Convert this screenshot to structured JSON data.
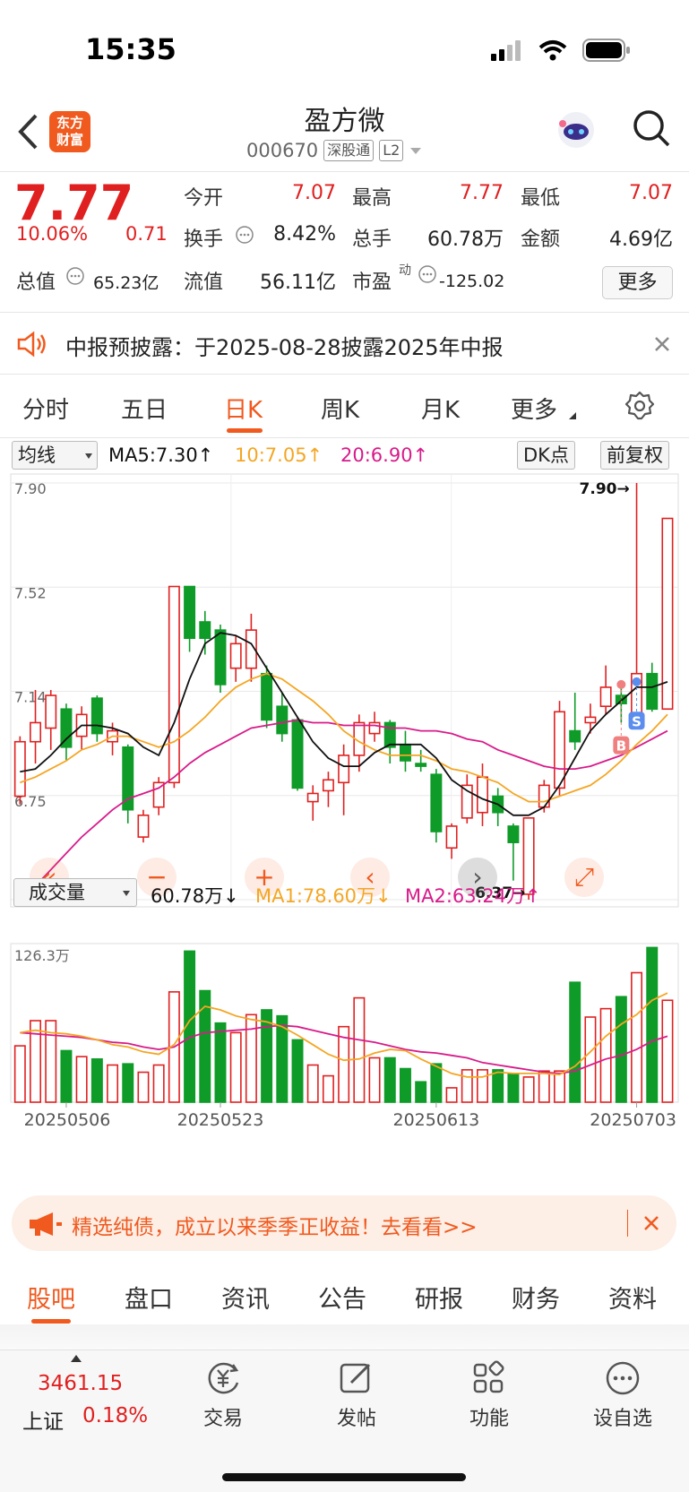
{
  "status": {
    "time": "15:35"
  },
  "header": {
    "logo_text": [
      "东方",
      "财富"
    ],
    "stock_name": "盈方微",
    "stock_code": "000670",
    "badge_market": "深股通",
    "badge_level": "L2"
  },
  "quote": {
    "price": "7.77",
    "change_pct": "10.06%",
    "change_amt": "0.71",
    "open_label": "今开",
    "open": "7.07",
    "high_label": "最高",
    "high": "7.77",
    "low_label": "最低",
    "low": "7.07",
    "turnover_label": "换手",
    "turnover": "8.42%",
    "volume_label": "总手",
    "volume": "60.78万",
    "amount_label": "金额",
    "amount": "4.69亿",
    "mktcap_label": "总值",
    "mktcap": "65.23亿",
    "float_label": "流值",
    "float": "56.11亿",
    "pe_label": "市盈",
    "pe_sup": "动",
    "pe": "-125.02",
    "more_label": "更多"
  },
  "notice": {
    "text": "中报预披露：于2025-08-28披露2025年中报"
  },
  "period_tabs": [
    {
      "label": "分时"
    },
    {
      "label": "五日"
    },
    {
      "label": "日K",
      "active": true
    },
    {
      "label": "周K"
    },
    {
      "label": "月K"
    },
    {
      "label": "更多"
    }
  ],
  "chart_controls": {
    "indicator": "均线",
    "ma5": "MA5:7.30↑",
    "ma10": "10:7.05↑",
    "ma20": "20:6.90↑",
    "dk": "DK点",
    "adjust": "前复权",
    "vol_indicator": "成交量",
    "vol_value": "60.78万↓",
    "vol_ma1": "MA1:78.60万↓",
    "vol_ma2": "MA2:63.24万↑"
  },
  "chart_data": {
    "type": "candlestick",
    "price_axis_ticks": [
      "7.90",
      "7.52",
      "7.14",
      "6.75",
      "6.37"
    ],
    "ylim": [
      6.37,
      7.9
    ],
    "annotations": {
      "max_label": "7.90→",
      "min_label": "6.37→",
      "buy_marker": "B",
      "sell_marker": "S"
    },
    "x_tick_labels": [
      "20250506",
      "20250523",
      "20250613",
      "20250703"
    ],
    "candles": [
      {
        "o": 6.75,
        "c": 6.95,
        "h": 6.97,
        "l": 6.72
      },
      {
        "o": 6.95,
        "c": 7.02,
        "h": 7.14,
        "l": 6.87
      },
      {
        "o": 7.0,
        "c": 7.12,
        "h": 7.14,
        "l": 6.92
      },
      {
        "o": 7.07,
        "c": 6.93,
        "h": 7.09,
        "l": 6.88
      },
      {
        "o": 6.97,
        "c": 7.05,
        "h": 7.08,
        "l": 6.92
      },
      {
        "o": 7.11,
        "c": 6.98,
        "h": 7.12,
        "l": 6.95
      },
      {
        "o": 6.95,
        "c": 6.99,
        "h": 7.02,
        "l": 6.9
      },
      {
        "o": 6.93,
        "c": 6.7,
        "h": 6.94,
        "l": 6.65
      },
      {
        "o": 6.6,
        "c": 6.68,
        "h": 6.7,
        "l": 6.58
      },
      {
        "o": 6.71,
        "c": 6.8,
        "h": 6.82,
        "l": 6.68
      },
      {
        "o": 6.8,
        "c": 7.52,
        "h": 7.52,
        "l": 6.78
      },
      {
        "o": 7.52,
        "c": 7.33,
        "h": 7.52,
        "l": 7.28
      },
      {
        "o": 7.39,
        "c": 7.33,
        "h": 7.43,
        "l": 7.27
      },
      {
        "o": 7.36,
        "c": 7.16,
        "h": 7.38,
        "l": 7.13
      },
      {
        "o": 7.22,
        "c": 7.31,
        "h": 7.34,
        "l": 7.17
      },
      {
        "o": 7.22,
        "c": 7.36,
        "h": 7.42,
        "l": 7.17
      },
      {
        "o": 7.2,
        "c": 7.03,
        "h": 7.23,
        "l": 7.0
      },
      {
        "o": 7.08,
        "c": 6.98,
        "h": 7.13,
        "l": 6.95
      },
      {
        "o": 7.03,
        "c": 6.78,
        "h": 7.04,
        "l": 6.77
      },
      {
        "o": 6.73,
        "c": 6.76,
        "h": 6.79,
        "l": 6.66
      },
      {
        "o": 6.77,
        "c": 6.81,
        "h": 6.84,
        "l": 6.71
      },
      {
        "o": 6.8,
        "c": 6.9,
        "h": 6.94,
        "l": 6.68
      },
      {
        "o": 6.9,
        "c": 7.02,
        "h": 7.05,
        "l": 6.84
      },
      {
        "o": 6.98,
        "c": 7.02,
        "h": 7.06,
        "l": 6.95
      },
      {
        "o": 7.02,
        "c": 6.93,
        "h": 7.03,
        "l": 6.87
      },
      {
        "o": 6.94,
        "c": 6.88,
        "h": 6.99,
        "l": 6.84
      },
      {
        "o": 6.87,
        "c": 6.86,
        "h": 6.92,
        "l": 6.84
      },
      {
        "o": 6.83,
        "c": 6.62,
        "h": 6.85,
        "l": 6.58
      },
      {
        "o": 6.56,
        "c": 6.64,
        "h": 6.65,
        "l": 6.52
      },
      {
        "o": 6.67,
        "c": 6.79,
        "h": 6.83,
        "l": 6.65
      },
      {
        "o": 6.69,
        "c": 6.82,
        "h": 6.87,
        "l": 6.64
      },
      {
        "o": 6.75,
        "c": 6.69,
        "h": 6.78,
        "l": 6.64
      },
      {
        "o": 6.64,
        "c": 6.58,
        "h": 6.65,
        "l": 6.44
      },
      {
        "o": 6.39,
        "c": 6.67,
        "h": 6.67,
        "l": 6.37
      },
      {
        "o": 6.71,
        "c": 6.79,
        "h": 6.81,
        "l": 6.69
      },
      {
        "o": 6.78,
        "c": 7.06,
        "h": 7.1,
        "l": 6.75
      },
      {
        "o": 6.99,
        "c": 6.95,
        "h": 7.13,
        "l": 6.92
      },
      {
        "o": 7.02,
        "c": 7.04,
        "h": 7.09,
        "l": 6.98
      },
      {
        "o": 7.08,
        "c": 7.15,
        "h": 7.23,
        "l": 7.05
      },
      {
        "o": 7.12,
        "c": 7.09,
        "h": 7.16,
        "l": 7.02
      },
      {
        "o": 7.05,
        "c": 7.2,
        "h": 7.9,
        "l": 7.04
      },
      {
        "o": 7.2,
        "c": 7.07,
        "h": 7.24,
        "l": 7.06
      },
      {
        "o": 7.07,
        "c": 7.77,
        "h": 7.77,
        "l": 7.07
      }
    ],
    "ma5": [
      6.84,
      6.85,
      6.9,
      6.96,
      7.01,
      7.01,
      7.0,
      6.98,
      6.93,
      6.9,
      7.02,
      7.18,
      7.31,
      7.35,
      7.34,
      7.31,
      7.22,
      7.13,
      7.04,
      6.95,
      6.89,
      6.86,
      6.86,
      6.91,
      6.94,
      6.94,
      6.94,
      6.89,
      6.81,
      6.77,
      6.74,
      6.72,
      6.68,
      6.68,
      6.71,
      6.79,
      6.89,
      6.99,
      7.05,
      7.1,
      7.15,
      7.15,
      7.17
    ],
    "ma10": [
      6.8,
      6.82,
      6.85,
      6.88,
      6.92,
      6.94,
      6.97,
      6.97,
      6.95,
      6.93,
      6.95,
      6.99,
      7.04,
      7.1,
      7.15,
      7.18,
      7.2,
      7.18,
      7.14,
      7.1,
      7.05,
      6.99,
      6.95,
      6.92,
      6.9,
      6.9,
      6.9,
      6.88,
      6.85,
      6.84,
      6.82,
      6.8,
      6.76,
      6.73,
      6.73,
      6.75,
      6.77,
      6.79,
      6.83,
      6.88,
      6.94,
      6.99,
      7.05
    ],
    "ma20": [
      6.38,
      6.42,
      6.48,
      6.54,
      6.6,
      6.65,
      6.7,
      6.74,
      6.76,
      6.78,
      6.82,
      6.87,
      6.91,
      6.94,
      6.97,
      7.0,
      7.01,
      7.02,
      7.03,
      7.02,
      7.02,
      7.01,
      7.01,
      7.01,
      7.0,
      7.0,
      6.99,
      6.99,
      6.98,
      6.96,
      6.95,
      6.92,
      6.9,
      6.88,
      6.86,
      6.85,
      6.85,
      6.86,
      6.88,
      6.9,
      6.93,
      6.96,
      6.99
    ],
    "vol_axis_max": "126.3万",
    "volumes": [
      47,
      68,
      68,
      43,
      38,
      36,
      31,
      32,
      25,
      31,
      92,
      126,
      93,
      66,
      58,
      73,
      77,
      72,
      52,
      31,
      22,
      63,
      87,
      37,
      37,
      28,
      17,
      32,
      12,
      27,
      27,
      27,
      24,
      21,
      26,
      26,
      100,
      71,
      78,
      88,
      108,
      129,
      85,
      62
    ],
    "vol_ma1": [
      58,
      60,
      58,
      57,
      55,
      52,
      48,
      46,
      42,
      40,
      48,
      68,
      80,
      77,
      72,
      69,
      67,
      63,
      56,
      48,
      40,
      35,
      36,
      41,
      44,
      43,
      36,
      30,
      24,
      21,
      21,
      25,
      24,
      24,
      24,
      23,
      30,
      42,
      55,
      65,
      73,
      85,
      91
    ],
    "vol_ma2": [
      58,
      57,
      56,
      55,
      54,
      52,
      50,
      49,
      46,
      44,
      46,
      54,
      58,
      59,
      60,
      61,
      63,
      64,
      63,
      60,
      57,
      54,
      52,
      50,
      47,
      44,
      42,
      41,
      39,
      37,
      33,
      31,
      29,
      27,
      25,
      24,
      26,
      31,
      36,
      39,
      44,
      51,
      55
    ]
  },
  "ad": {
    "text": "精选纯债，成立以来季季正收益！去看看>>"
  },
  "bottom_tabs": [
    "股吧",
    "盘口",
    "资讯",
    "公告",
    "研报",
    "财务",
    "资料"
  ],
  "dock": {
    "index_value": "3461.15",
    "index_name": "上证",
    "index_pct": "0.18%",
    "items": [
      "交易",
      "发帖",
      "功能",
      "设自选"
    ]
  },
  "colors": {
    "up": "#e02020",
    "down": "#0e9b28",
    "accent": "#f05a1e",
    "ma5": "#111111",
    "ma10": "#f4a623",
    "ma20": "#d81b8a"
  }
}
